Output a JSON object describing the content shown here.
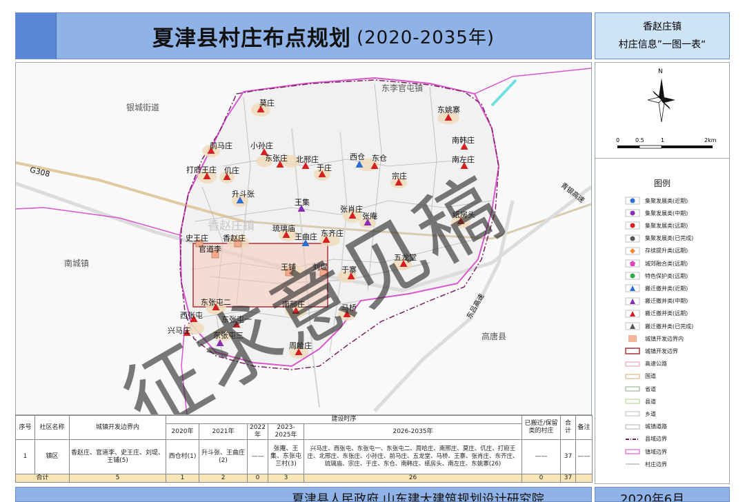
{
  "header": {
    "title": "夏津县村庄布点规划",
    "title_years": "(2020-2035年)",
    "info_line1": "香赵庄镇",
    "info_line2": "村庄信息”一图一表“"
  },
  "map": {
    "neighbors": [
      {
        "name": "东李官屯镇"
      },
      {
        "name": "银城街道"
      },
      {
        "name": "南城镇"
      },
      {
        "name": "高唐县"
      }
    ],
    "roads": [
      {
        "name": "G308"
      },
      {
        "name": "青银高速"
      },
      {
        "name": "东吕高速"
      }
    ],
    "town_label": "香赵庄镇",
    "villages": [
      {
        "name": "莫庄",
        "symbol": "triangle",
        "color": "#d42020"
      },
      {
        "name": "东姚寨",
        "symbol": "triangle",
        "color": "#d42020"
      },
      {
        "name": "前马庄",
        "symbol": "triangle",
        "color": "#d42020"
      },
      {
        "name": "小孙庄",
        "symbol": "triangle",
        "color": "#d42020"
      },
      {
        "name": "东张庄",
        "symbol": "triangle",
        "color": "#d42020"
      },
      {
        "name": "北邢庄",
        "symbol": "triangle",
        "color": "#d42020"
      },
      {
        "name": "西仓",
        "symbol": "triangle",
        "color": "#2a6fd1"
      },
      {
        "name": "东仓",
        "symbol": "triangle",
        "color": "#d42020"
      },
      {
        "name": "南韩庄",
        "symbol": "triangle",
        "color": "#d42020"
      },
      {
        "name": "南左庄",
        "symbol": "triangle",
        "color": "#d42020"
      },
      {
        "name": "打府王庄",
        "symbol": "triangle",
        "color": "#d42020"
      },
      {
        "name": "仉庄",
        "symbol": "triangle",
        "color": "#d42020"
      },
      {
        "name": "于庄",
        "symbol": "triangle",
        "color": "#d42020"
      },
      {
        "name": "宗庄",
        "symbol": "triangle",
        "color": "#d42020"
      },
      {
        "name": "升斗张",
        "symbol": "triangle",
        "color": "#2a6fd1"
      },
      {
        "name": "王集",
        "symbol": "triangle",
        "color": "#8a2bb5"
      },
      {
        "name": "张肖庄",
        "symbol": "triangle",
        "color": "#d42020"
      },
      {
        "name": "张庵",
        "symbol": "triangle",
        "color": "#8a2bb5"
      },
      {
        "name": "纸房头",
        "symbol": "triangle",
        "color": "#d42020"
      },
      {
        "name": "琉璃庙",
        "symbol": "triangle",
        "color": "#d42020"
      },
      {
        "name": "王曲庄",
        "symbol": "triangle",
        "color": "#2a6fd1"
      },
      {
        "name": "东齐庄",
        "symbol": "triangle",
        "color": "#d42020"
      },
      {
        "name": "史王庄",
        "symbol": "square",
        "color": "#f2a98b"
      },
      {
        "name": "香赵庄",
        "symbol": "square",
        "color": "#f2a98b"
      },
      {
        "name": "官道李",
        "symbol": "square",
        "color": "#f2a98b"
      },
      {
        "name": "王铺",
        "symbol": "square",
        "color": "#f2a98b"
      },
      {
        "name": "刘堤",
        "symbol": "square",
        "color": "#f2a98b"
      },
      {
        "name": "五龙堂",
        "symbol": "triangle",
        "color": "#d42020"
      },
      {
        "name": "于寨",
        "symbol": "triangle",
        "color": "#d42020"
      },
      {
        "name": "东张屯二",
        "symbol": "triangle",
        "color": "#d42020"
      },
      {
        "name": "西张屯",
        "symbol": "triangle",
        "color": "#d42020"
      },
      {
        "name": "东张屯一",
        "symbol": "triangle",
        "color": "#d42020"
      },
      {
        "name": "南邢庄",
        "symbol": "triangle",
        "color": "#d42020"
      },
      {
        "name": "马桥",
        "symbol": "triangle",
        "color": "#d42020"
      },
      {
        "name": "兴马庄",
        "symbol": "triangle",
        "color": "#d42020"
      },
      {
        "name": "东张屯三",
        "symbol": "triangle",
        "color": "#8a2bb5"
      },
      {
        "name": "周哈庄",
        "symbol": "triangle",
        "color": "#d42020"
      }
    ],
    "watermark": "征求意见稿"
  },
  "compass": {
    "north": "N",
    "scale_labels": [
      "0",
      "0.5",
      "1",
      "2km"
    ]
  },
  "legend": {
    "title": "图例",
    "items": [
      {
        "label": "集聚发展类(近期)",
        "symbol": "circle",
        "color": "#2a6fd1"
      },
      {
        "label": "集聚发展类(中期)",
        "symbol": "circle",
        "color": "#8a2bb5"
      },
      {
        "label": "集聚发展类(远期)",
        "symbol": "circle",
        "color": "#d42020"
      },
      {
        "label": "集聚发展类(已完成)",
        "symbol": "circle",
        "color": "#555555"
      },
      {
        "label": "存续提升类(远期)",
        "symbol": "diamond",
        "color": "#f08a30"
      },
      {
        "label": "城郊融合类(远期)",
        "symbol": "pentagon",
        "color": "#e040c0"
      },
      {
        "label": "特色保护类(远期)",
        "symbol": "circle",
        "color": "#2fa84a"
      },
      {
        "label": "搬迁撤并类(近期)",
        "symbol": "triangle",
        "color": "#2a6fd1"
      },
      {
        "label": "搬迁撤并类(中期)",
        "symbol": "triangle",
        "color": "#8a2bb5"
      },
      {
        "label": "搬迁撤并类(远期)",
        "symbol": "triangle",
        "color": "#d42020"
      },
      {
        "label": "搬迁撤并类(已完成)",
        "symbol": "triangle",
        "color": "#555555"
      },
      {
        "label": "城镇开发边界内",
        "symbol": "fill",
        "color": "#f2b49b"
      },
      {
        "label": "城镇开发边界",
        "symbol": "outline",
        "color": "#a8323a"
      },
      {
        "label": "高速公路",
        "symbol": "line2",
        "color": "#e6a6ad"
      },
      {
        "label": "国道",
        "symbol": "line2",
        "color": "#d9b98c"
      },
      {
        "label": "省道",
        "symbol": "line2",
        "color": "#9fb59f"
      },
      {
        "label": "县道",
        "symbol": "line2",
        "color": "#bcd6a2"
      },
      {
        "label": "乡道",
        "symbol": "line2",
        "color": "#c9c9c9"
      },
      {
        "label": "城镇道路",
        "symbol": "line2",
        "color": "#bdbdbd"
      },
      {
        "label": "县域边界",
        "symbol": "dashdot",
        "color": "#6b1f57"
      },
      {
        "label": "镇域边界",
        "symbol": "line2",
        "color": "#e05ad2"
      },
      {
        "label": "村庄边界",
        "symbol": "line",
        "color": "#9a9a9a"
      }
    ]
  },
  "table": {
    "head": {
      "seq": "序号",
      "community": "社区名称",
      "town_boundary": "城镇开发边界内",
      "build_period": "建设时序",
      "y2020": "2020年",
      "y2021": "2021年",
      "y2022": "2022年",
      "y2023": "2023-2025年",
      "y2026": "2026-2035年",
      "relocated": "已搬迁/保留类的村庄",
      "total": "合计",
      "note": "备注"
    },
    "row": {
      "seq": "1",
      "community": "镇区",
      "town_boundary": "香赵庄、官道李、史王庄、刘堤、王铺(5)",
      "y2020": "西仓村(1)",
      "y2021": "升斗张、王曲庄(2)",
      "y2022": "——",
      "y2023": "张庵、王集、东张屯三村(3)",
      "y2026": "兴马庄、西张屯、东张屯一、东张屯二、周哈庄、南邢庄、莫庄、仉庄、打府王庄、北邢庄、东张庄、小孙庄、前马庄、五龙堂、马桥、王寨、张肖庄、东齐庄、琉璃庙、宗庄、于庄、东仓、南韩庄、纸房头、南左庄、东姚寨(26)",
      "relocated": "——",
      "total": "37",
      "note": "——"
    },
    "sum": {
      "label": "合计",
      "town_boundary": "5",
      "y2020": "1",
      "y2021": "2",
      "y2022": "0",
      "y2023": "3",
      "y2026": "26",
      "relocated": "0",
      "total": "37"
    }
  },
  "footer": {
    "org": "夏津县人民政府 山东建大建筑规划设计研究院",
    "date": "2020年6月"
  }
}
